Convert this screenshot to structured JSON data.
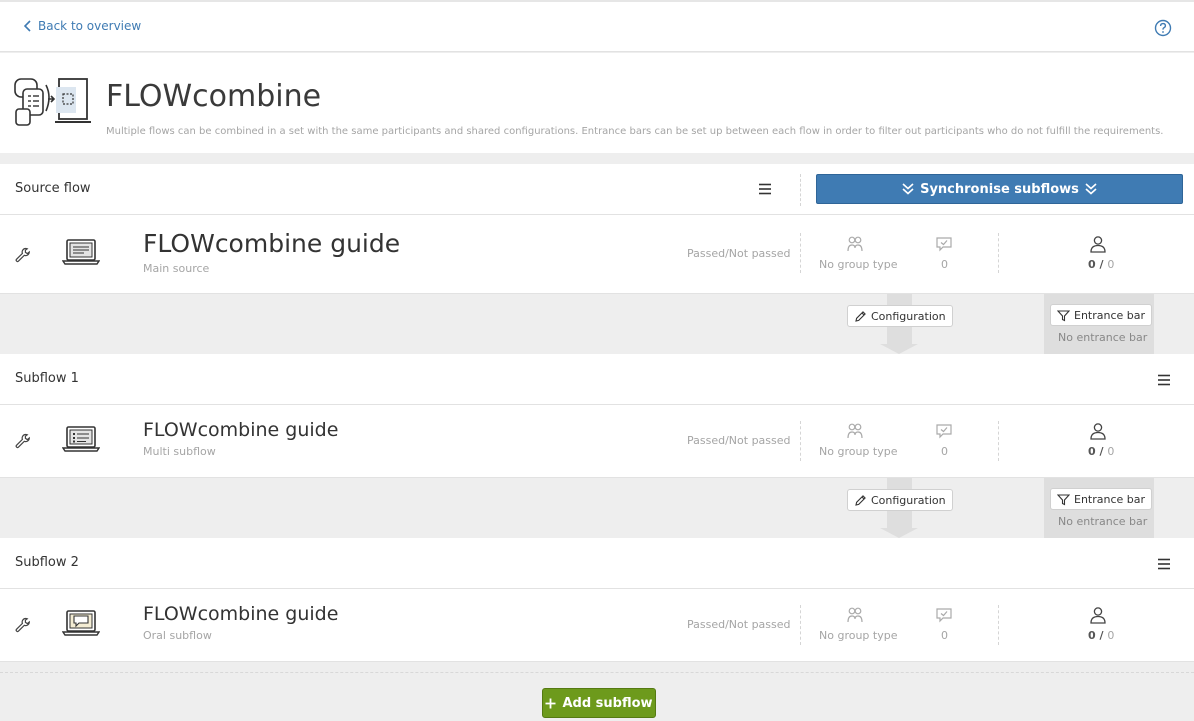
{
  "nav": {
    "back_label": "Back to overview"
  },
  "header": {
    "title": "FLOWcombine",
    "description": "Multiple flows can be combined in a set with the same participants and shared configurations. Entrance bars can be set up between each flow in order to filter out participants who do not fulfill the requirements."
  },
  "source": {
    "label": "Source flow",
    "sync_label": "Synchronise subflows",
    "flow": {
      "title": "FLOWcombine guide",
      "subtitle": "Main source",
      "status": "Passed/Not passed",
      "group_type": "No group type",
      "feedback_count": "0",
      "participants_current": "0",
      "participants_sep": "/",
      "participants_total": "0"
    }
  },
  "connectors": [
    {
      "config_label": "Configuration",
      "entrance_label": "Entrance bar",
      "entrance_status": "No entrance bar"
    },
    {
      "config_label": "Configuration",
      "entrance_label": "Entrance bar",
      "entrance_status": "No entrance bar"
    }
  ],
  "subflows": [
    {
      "label": "Subflow 1",
      "flow": {
        "title": "FLOWcombine guide",
        "subtitle": "Multi subflow",
        "status": "Passed/Not passed",
        "group_type": "No group type",
        "feedback_count": "0",
        "participants_current": "0",
        "participants_sep": "/",
        "participants_total": "0"
      }
    },
    {
      "label": "Subflow 2",
      "flow": {
        "title": "FLOWcombine guide",
        "subtitle": "Oral subflow",
        "status": "Passed/Not passed",
        "group_type": "No group type",
        "feedback_count": "0",
        "participants_current": "0",
        "participants_sep": "/",
        "participants_total": "0"
      }
    }
  ],
  "footer": {
    "add_label": "Add subflow"
  },
  "colors": {
    "primary": "#3f7bb3",
    "success": "#6d9a1c",
    "muted": "#a5a5a5",
    "background": "#eeeeee"
  },
  "icons": [
    "chevron-left-icon",
    "help-icon",
    "menu-icon",
    "wrench-icon",
    "laptop-icon",
    "group-icon",
    "chat-check-icon",
    "user-icon",
    "pencil-icon",
    "filter-icon",
    "plus-icon",
    "double-chevron-down-icon"
  ]
}
